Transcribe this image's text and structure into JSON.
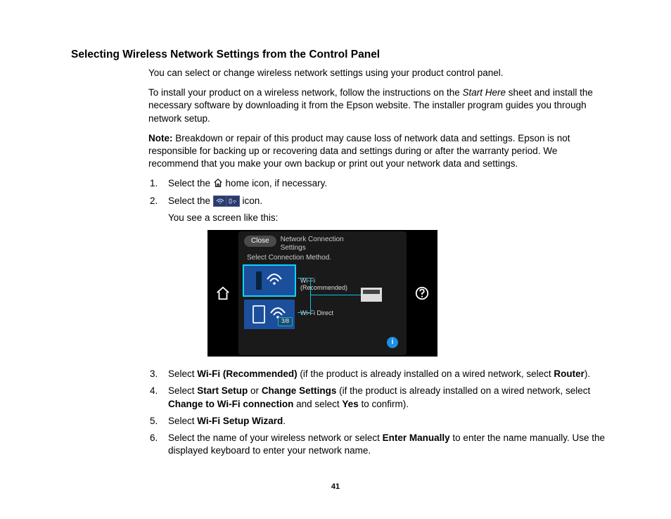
{
  "heading": "Selecting Wireless Network Settings from the Control Panel",
  "p1": "You can select or change wireless network settings using your product control panel.",
  "p2a": "To install your product on a wireless network, follow the instructions on the ",
  "p2b_em": "Start Here",
  "p2c": " sheet and install the necessary software by downloading it from the Epson website. The installer program guides you through network setup.",
  "note_label": "Note:",
  "note_text": " Breakdown or repair of this product may cause loss of network data and settings. Epson is not responsible for backing up or recovering data and settings during or after the warranty period. We recommend that you make your own backup or print out your network data and settings.",
  "step1_a": "Select the ",
  "step1_b": " home icon, if necessary.",
  "step2_a": "Select the ",
  "step2_b": " icon.",
  "step2_sub": "You see a screen like this:",
  "device": {
    "close": "Close",
    "header_title": "Network Connection\nSettings",
    "subtitle": "Select Connection Method.",
    "option1": "Wi-Fi\n(Recommended)",
    "option2": "Wi-Fi Direct",
    "page_badge": "3/8",
    "info": "i"
  },
  "step3_a": "Select ",
  "step3_b": "Wi-Fi (Recommended)",
  "step3_c": " (if the product is already installed on a wired network, select ",
  "step3_d": "Router",
  "step3_e": ").",
  "step4_a": "Select ",
  "step4_b": "Start Setup",
  "step4_c": " or ",
  "step4_d": "Change Settings",
  "step4_e": " (if the product is already installed on a wired network, select ",
  "step4_f": "Change to Wi-Fi connection",
  "step4_g": " and select ",
  "step4_h": "Yes",
  "step4_i": " to confirm).",
  "step5_a": "Select ",
  "step5_b": "Wi-Fi Setup Wizard",
  "step5_c": ".",
  "step6_a": "Select the name of your wireless network or select ",
  "step6_b": "Enter Manually",
  "step6_c": " to enter the name manually. Use the displayed keyboard to enter your network name.",
  "page_number": "41"
}
